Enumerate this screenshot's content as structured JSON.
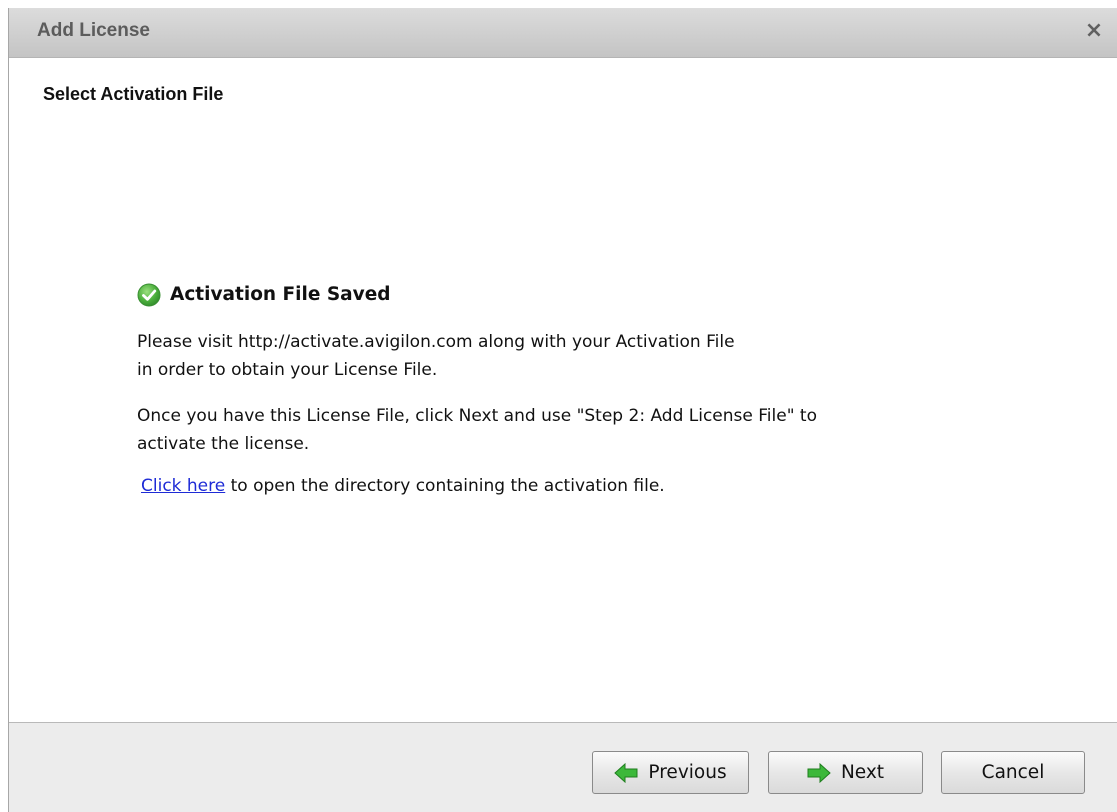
{
  "dialog": {
    "title": "Add License",
    "close_glyph": "×"
  },
  "step": {
    "title": "Select Activation File"
  },
  "status": {
    "icon": "check-circle-icon",
    "text": "Activation File Saved",
    "icon_color": "#4caf3d"
  },
  "body": {
    "para1_line1": "Please visit http://activate.avigilon.com along with your Activation File",
    "para1_line2": "in order to obtain your License File.",
    "para2_line1": "Once you have this License File, click Next and use \"Step 2: Add License File\" to",
    "para2_line2": "activate the license.",
    "link_text": "Click here",
    "link_suffix": " to open the directory containing the activation file."
  },
  "footer": {
    "previous_label": "Previous",
    "next_label": "Next",
    "cancel_label": "Cancel",
    "previous_icon": "arrow-left-icon",
    "next_icon": "arrow-right-icon",
    "arrow_color": "#3cb83a"
  }
}
